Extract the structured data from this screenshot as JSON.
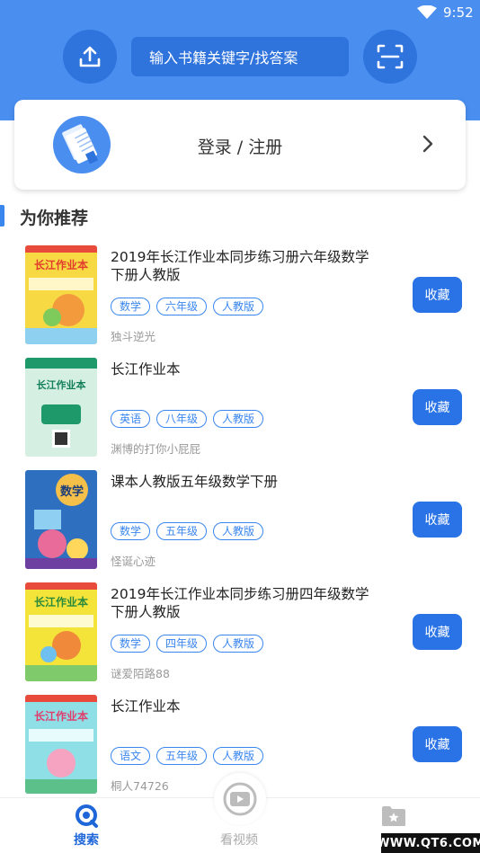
{
  "status_bar": {
    "time": "9:52",
    "wifi_icon": "wifi-icon"
  },
  "header": {
    "upload_icon": "upload-icon",
    "search_placeholder": "输入书籍关键字/找答案",
    "scan_icon": "scan-icon"
  },
  "login": {
    "label": "登录 / 注册"
  },
  "section": {
    "title": "为你推荐"
  },
  "books": [
    {
      "title": "2019年长江作业本同步练习册六年级数学下册人教版",
      "tags": [
        "数学",
        "六年级",
        "人教版"
      ],
      "author": "独斗逆光",
      "button": "收藏",
      "cover_text": "长江作业本"
    },
    {
      "title": "长江作业本",
      "tags": [
        "英语",
        "八年级",
        "人教版"
      ],
      "author": "渊博的打你小屁屁",
      "button": "收藏",
      "cover_text": "长江作业本"
    },
    {
      "title": "课本人教版五年级数学下册",
      "tags": [
        "数学",
        "五年级",
        "人教版"
      ],
      "author": "怪诞心迹",
      "button": "收藏",
      "cover_text": "数学"
    },
    {
      "title": "2019年长江作业本同步练习册四年级数学下册人教版",
      "tags": [
        "数学",
        "四年级",
        "人教版"
      ],
      "author": "谜爱陌路88",
      "button": "收藏",
      "cover_text": "长江作业本"
    },
    {
      "title": "长江作业本",
      "tags": [
        "语文",
        "五年级",
        "人教版"
      ],
      "author": "桐人74726",
      "button": "收藏",
      "cover_text": "长江作业本"
    }
  ],
  "tabbar": {
    "search_label": "搜索",
    "video_label": "看视频",
    "fav_label": ""
  },
  "watermark": "WWW.QT6.COM",
  "colors": {
    "primary": "#4a8ef0",
    "button": "#2a73e6",
    "accent": "#1f66d8"
  }
}
